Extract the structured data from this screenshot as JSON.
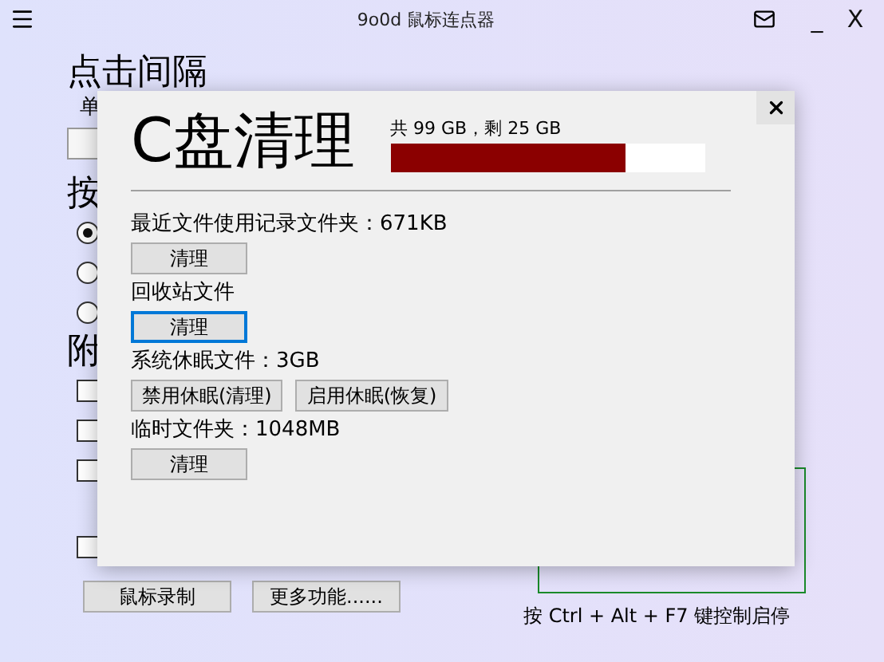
{
  "app": {
    "title": "9o0d 鼠标连点器",
    "window_controls": [
      "_",
      "X"
    ]
  },
  "main": {
    "interval_heading": "点击间隔",
    "unit_label": "单",
    "mode_heading": "按",
    "radios": [
      {
        "selected": true
      },
      {
        "selected": false
      },
      {
        "selected": false
      }
    ],
    "extra_heading": "附",
    "checkboxes": [
      {
        "checked": false
      },
      {
        "checked": false
      },
      {
        "checked": false
      },
      {
        "checked": false
      }
    ],
    "buttons": [
      "鼠标录制",
      "更多功能......"
    ],
    "hotkey_hint": "按 Ctrl + Alt + F7 键控制启停"
  },
  "dialog": {
    "title": "C盘清理",
    "disk_info": "共 99 GB，剩 25 GB",
    "usage": {
      "level": 0.75
    },
    "sections": [
      {
        "label": "最近文件使用记录文件夹：671KB",
        "buttons": [
          {
            "label": "清理",
            "focused": false
          }
        ]
      },
      {
        "label": "回收站文件",
        "buttons": [
          {
            "label": "清理",
            "focused": true
          }
        ]
      },
      {
        "label": "系统休眠文件：3GB",
        "buttons": [
          {
            "label": "禁用休眠(清理)",
            "focused": false
          },
          {
            "label": "启用休眠(恢复)",
            "focused": false
          }
        ]
      },
      {
        "label": "临时文件夹：1048MB",
        "buttons": [
          {
            "label": "清理",
            "focused": false
          }
        ]
      }
    ]
  }
}
